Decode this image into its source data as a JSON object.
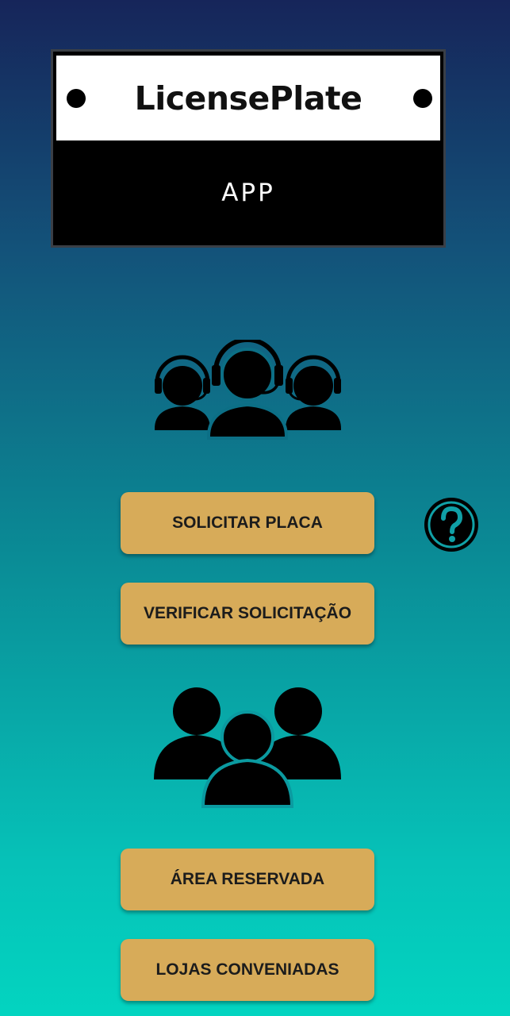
{
  "logo": {
    "title": "LicensePlate",
    "subtitle": "APP"
  },
  "buttons": {
    "solicitar_placa": "SOLICITAR PLACA",
    "verificar_solicitacao": "VERIFICAR SOLICITAÇÃO",
    "area_reservada": "ÁREA RESERVADA",
    "lojas_conveniadas": "LOJAS CONVENIADAS"
  },
  "icons": {
    "support": "customer-support-icon",
    "help": "help-icon",
    "group": "users-group-icon"
  },
  "colors": {
    "button": "#d7ab59",
    "button_text": "#1c1c1c",
    "gradient_top": "#16255a",
    "gradient_bottom": "#03d4c0"
  }
}
